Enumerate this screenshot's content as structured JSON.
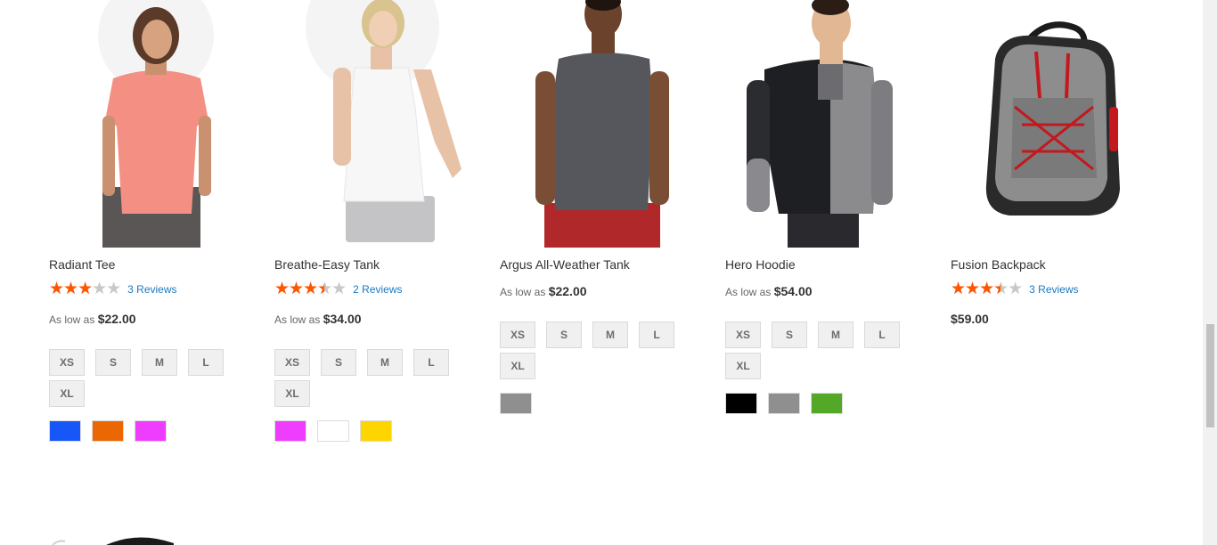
{
  "products": [
    {
      "name": "Radiant Tee",
      "rating": 0.6,
      "reviews": "3 Reviews",
      "price_prefix": "As low as",
      "price": "$22.00",
      "sizes": [
        "XS",
        "S",
        "M",
        "L",
        "XL"
      ],
      "swatches": [
        "#1857f7",
        "#eb6703",
        "#ef3dff"
      ]
    },
    {
      "name": "Breathe-Easy Tank",
      "rating": 0.7,
      "reviews": "2 Reviews",
      "price_prefix": "As low as",
      "price": "$34.00",
      "sizes": [
        "XS",
        "S",
        "M",
        "L",
        "XL"
      ],
      "swatches": [
        "#ef3dff",
        "#ffffff",
        "#ffd500"
      ]
    },
    {
      "name": "Argus All-Weather Tank",
      "price_prefix": "As low as",
      "price": "$22.00",
      "sizes": [
        "XS",
        "S",
        "M",
        "L",
        "XL"
      ],
      "swatches": [
        "#8f8f8f"
      ]
    },
    {
      "name": "Hero Hoodie",
      "price_prefix": "As low as",
      "price": "$54.00",
      "sizes": [
        "XS",
        "S",
        "M",
        "L",
        "XL"
      ],
      "swatches": [
        "#000000",
        "#8f8f8f",
        "#53a828"
      ]
    },
    {
      "name": "Fusion Backpack",
      "rating": 0.7,
      "reviews": "3 Reviews",
      "price_prefix": "",
      "price": "$59.00",
      "sizes": [],
      "swatches": []
    }
  ],
  "colors": {
    "star": "#ff5501",
    "link": "#1979c3"
  }
}
